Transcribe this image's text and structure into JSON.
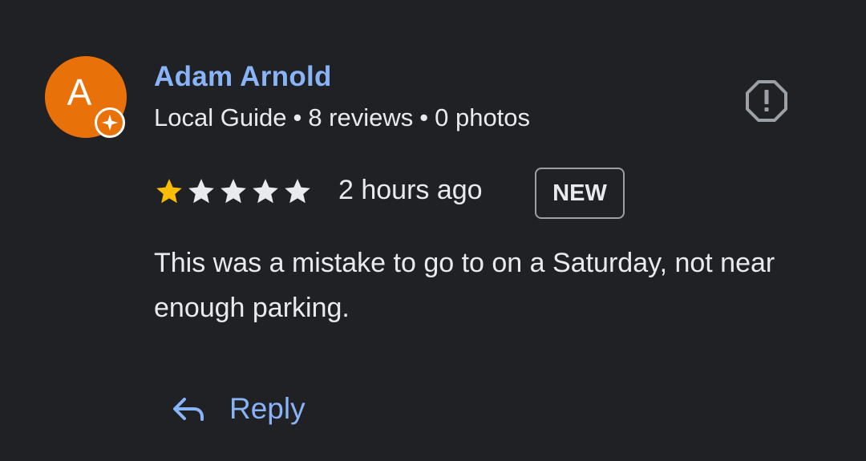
{
  "review": {
    "author": {
      "name": "Adam Arnold",
      "initial": "A",
      "avatar_color": "#e8710a",
      "badge_icon": "local-guide-sparkle-icon",
      "meta": {
        "level": "Local Guide",
        "reviews": "8 reviews",
        "photos": "0 photos",
        "separator": "•"
      }
    },
    "report_icon": "report-octagon-exclamation-icon",
    "rating": 1,
    "rating_max": 5,
    "time_ago": "2 hours ago",
    "badge": "NEW",
    "text": "This was a mistake to go to on a Saturday, not near enough parking."
  },
  "actions": {
    "reply_label": "Reply",
    "reply_icon": "reply-arrow-icon"
  },
  "colors": {
    "background": "#202124",
    "link": "#8ab4f8",
    "text": "#e8eaed",
    "star_filled": "#fbbc04",
    "star_empty": "#e8eaed",
    "icon_muted": "#9aa0a6"
  }
}
